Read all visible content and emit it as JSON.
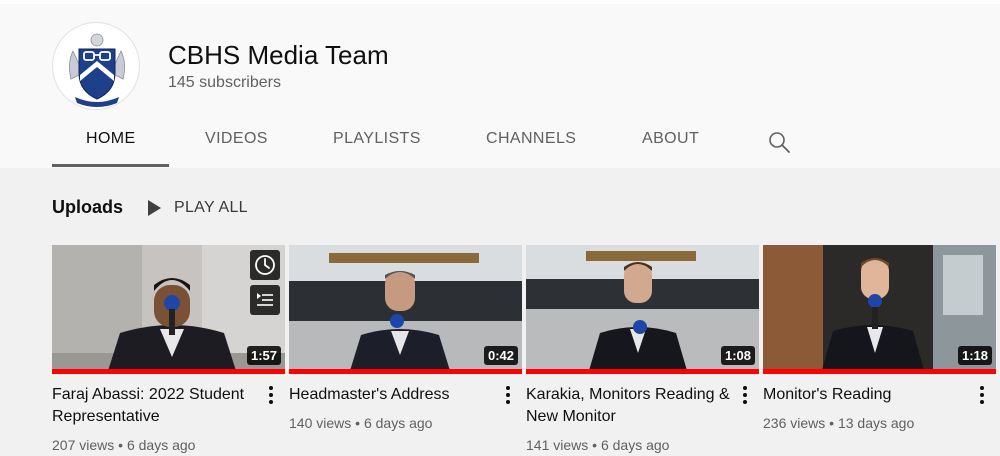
{
  "channel": {
    "name": "CBHS Media Team",
    "subscribers": "145 subscribers"
  },
  "tabs": [
    {
      "label": "HOME"
    },
    {
      "label": "VIDEOS"
    },
    {
      "label": "PLAYLISTS"
    },
    {
      "label": "CHANNELS"
    },
    {
      "label": "ABOUT"
    }
  ],
  "section": {
    "title": "Uploads",
    "play_all": "PLAY ALL"
  },
  "videos": [
    {
      "title": "Faraj Abassi: 2022 Student Representative",
      "views": "207 views",
      "age": "6 days ago",
      "duration": "1:57"
    },
    {
      "title": "Headmaster's Address",
      "views": "140 views",
      "age": "6 days ago",
      "duration": "0:42"
    },
    {
      "title": "Karakia, Monitors Reading & New Monitor",
      "views": "141 views",
      "age": "6 days ago",
      "duration": "1:08"
    },
    {
      "title": "Monitor's Reading",
      "views": "236 views",
      "age": "13 days ago",
      "duration": "1:18"
    }
  ],
  "icons": {
    "search": "search-icon",
    "play": "play-icon",
    "watch_later": "clock-icon",
    "add_to_queue": "queue-icon",
    "more": "more-vert-icon"
  },
  "colors": {
    "accent": "#ff0000",
    "header_bg": "#f9f9f9",
    "page_bg": "#f1f1f1",
    "crest_blue": "#1e3f8a"
  }
}
